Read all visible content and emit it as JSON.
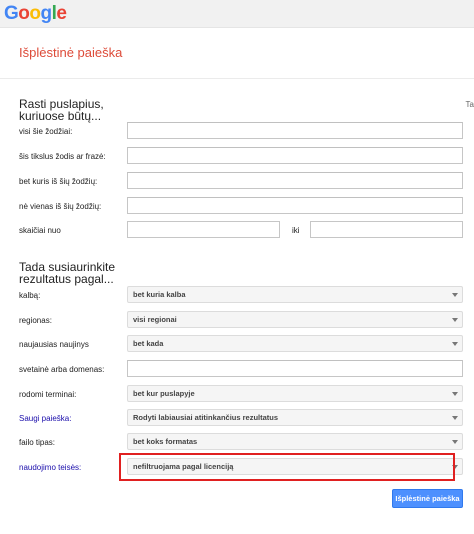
{
  "header": {
    "logo_letters": [
      "G",
      "o",
      "o",
      "g",
      "l",
      "e"
    ],
    "logo_colors": [
      "#4285f4",
      "#ea4335",
      "#fbbc05",
      "#4285f4",
      "#34a853",
      "#ea4335"
    ]
  },
  "page": {
    "title": "Išplėstinė paieška",
    "right_clip_text": "Ta"
  },
  "find_pages": {
    "heading": "Rasti puslapius, kuriuose būtų...",
    "fields": [
      {
        "label": "visi šie žodžiai:",
        "value": ""
      },
      {
        "label": "šis tikslus žodis ar frazė:",
        "value": ""
      },
      {
        "label": "bet kuris iš šių žodžių:",
        "value": ""
      },
      {
        "label": "nė vienas iš šių žodžių:",
        "value": ""
      }
    ],
    "number_range": {
      "label": "skaičiai nuo",
      "between_label": "iki",
      "from_value": "",
      "to_value": ""
    }
  },
  "narrow": {
    "heading": "Tada susiaurinkite rezultatus pagal...",
    "rows": [
      {
        "label": "kalbą:",
        "value": "bet kuria kalba"
      },
      {
        "label": "regionas:",
        "value": "visi regionai"
      },
      {
        "label": "naujausias naujinys",
        "value": "bet kada"
      },
      {
        "label": "svetainė arba domenas:",
        "value": ""
      },
      {
        "label": "rodomi terminai:",
        "value": "bet kur puslapyje"
      },
      {
        "label": "Saugi paieška:",
        "value": "Rodyti labiausiai atitinkančius rezultatus"
      },
      {
        "label": "failo tipas:",
        "value": "bet koks formatas"
      },
      {
        "label": "naudojimo teisės:",
        "value": "nefiltruojama pagal licenciją"
      }
    ]
  },
  "actions": {
    "submit_label": "Išplėstinė paieška"
  },
  "colors": {
    "title_red": "#dd4b39",
    "link_blue": "#1a0dab",
    "button_blue": "#4d90fe",
    "highlight_red": "#e02020"
  }
}
